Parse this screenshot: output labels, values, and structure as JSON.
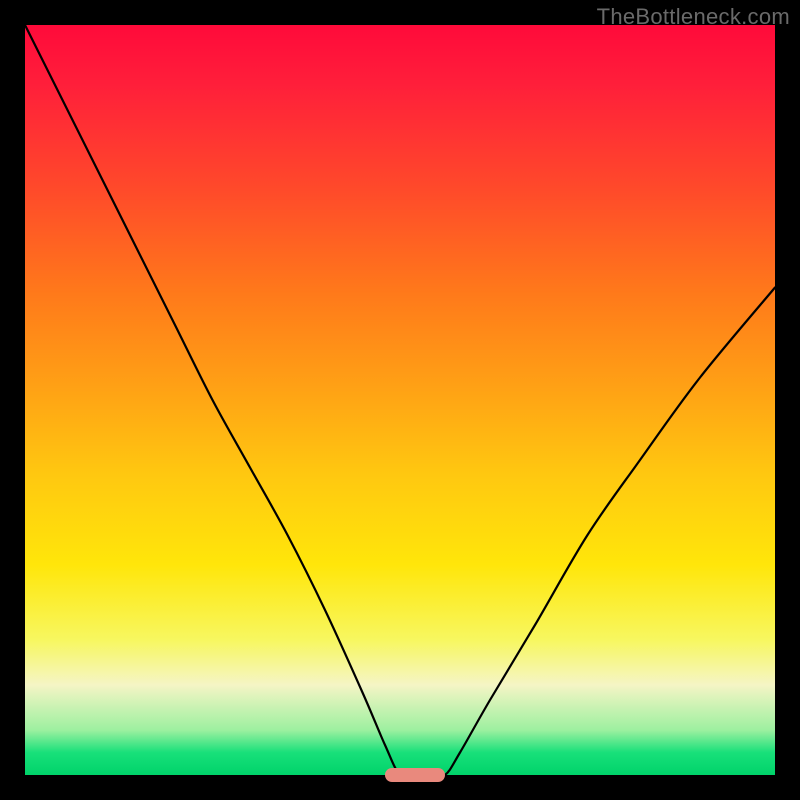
{
  "watermark": "TheBottleneck.com",
  "chart_data": {
    "type": "line",
    "title": "",
    "xlabel": "",
    "ylabel": "",
    "xlim": [
      0,
      100
    ],
    "ylim": [
      0,
      100
    ],
    "grid": false,
    "legend": false,
    "background_gradient": {
      "top": "#ff0a3a",
      "upper_mid": "#ffa015",
      "lower_mid": "#ffe60a",
      "bottom": "#00d36a"
    },
    "series": [
      {
        "name": "bottleneck-curve",
        "color": "#000000",
        "x": [
          0,
          5,
          10,
          15,
          20,
          25,
          30,
          35,
          40,
          45,
          48,
          50,
          52,
          54,
          56,
          58,
          62,
          68,
          75,
          82,
          90,
          100
        ],
        "values": [
          100,
          90,
          80,
          70,
          60,
          50,
          41,
          32,
          22,
          11,
          4,
          0,
          0,
          0,
          0,
          3,
          10,
          20,
          32,
          42,
          53,
          65
        ]
      }
    ],
    "marker": {
      "name": "optimal-range",
      "x_start": 48,
      "x_end": 56,
      "y": 0,
      "color": "#e9897d"
    }
  }
}
